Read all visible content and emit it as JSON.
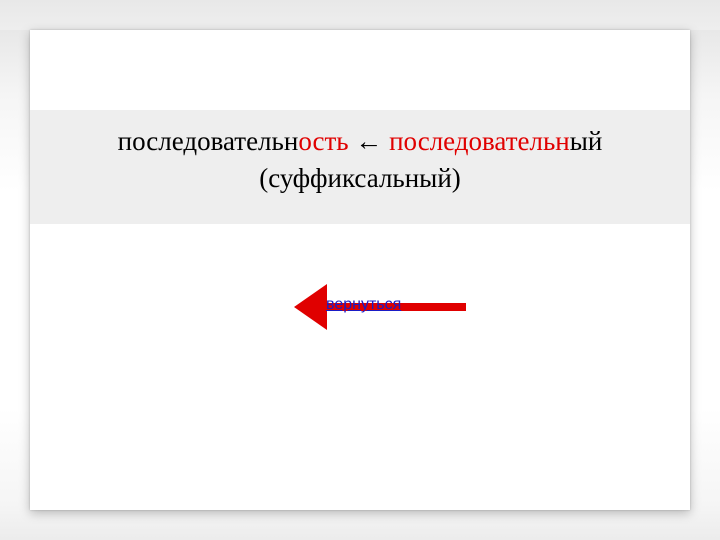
{
  "colors": {
    "accent_red": "#e00000",
    "link_blue": "#1a1cc6",
    "box_bg": "#eeeeee"
  },
  "line1": {
    "p1_black": "последовательн",
    "p2_red": "ость",
    "arrow": " ← ",
    "p3_red": "последовательн",
    "p4_black": "ый"
  },
  "line2": "(суффиксальный)",
  "back_link": "вернуться"
}
